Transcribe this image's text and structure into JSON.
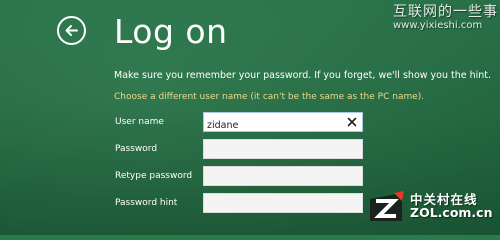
{
  "colors": {
    "background": "#236e43",
    "text": "#ffffff",
    "hint": "#ebd98a",
    "field": "#f4f4f4"
  },
  "header": {
    "back_icon": "back-arrow-icon",
    "title": "Log on"
  },
  "instruction": "Make sure you remember your password. If you forget, we'll show you the hint.",
  "hint_text": "Choose a different user name (it can't be the same as the PC name).",
  "form": {
    "username": {
      "label": "User name",
      "value": "zidane",
      "clear_icon": "close-icon"
    },
    "password": {
      "label": "Password",
      "value": ""
    },
    "retype_password": {
      "label": "Retype password",
      "value": ""
    },
    "password_hint": {
      "label": "Password hint",
      "value": ""
    }
  },
  "watermark": {
    "cn": "互联网的一些事",
    "url": "www.yixieshi.com"
  },
  "logo": {
    "cn": "中关村在线",
    "url": "ZOL.com.cn"
  }
}
